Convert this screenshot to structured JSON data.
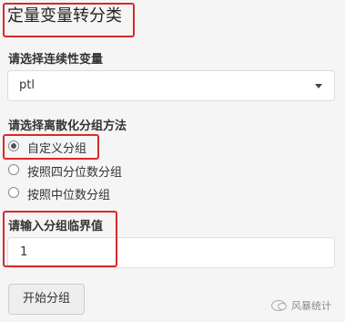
{
  "panel": {
    "title": "定量变量转分类",
    "continuous_variable": {
      "label": "请选择连续性变量",
      "selected_value": "ptl"
    },
    "discretization": {
      "label": "请选择离散化分组方法",
      "options": [
        {
          "label": "自定义分组",
          "checked": true
        },
        {
          "label": "按照四分位数分组",
          "checked": false
        },
        {
          "label": "按照中位数分组",
          "checked": false
        }
      ]
    },
    "threshold": {
      "label": "请输入分组临界值",
      "value": "1"
    },
    "start_button": "开始分组"
  },
  "watermark": {
    "text": "风暴统计",
    "icon": "wechat-icon"
  },
  "colors": {
    "highlight": "#d62a2a",
    "background": "#f5f5f5"
  }
}
